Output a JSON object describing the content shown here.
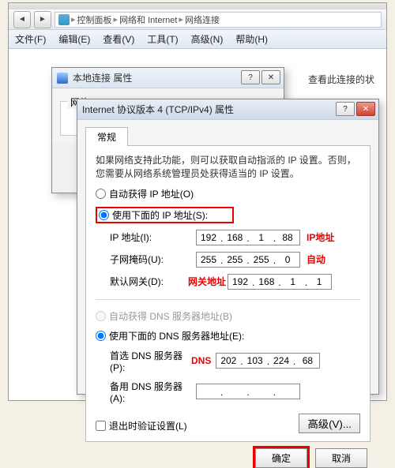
{
  "breadcrumb": {
    "item1": "控制面板",
    "item2": "网络和 Internet",
    "item3": "网络连接"
  },
  "menu": {
    "file": "文件(F)",
    "edit": "编辑(E)",
    "view": "查看(V)",
    "tools": "工具(T)",
    "advanced": "高级(N)",
    "help": "帮助(H)"
  },
  "statusHint": "查看此连接的状",
  "propDialog": {
    "title": "本地连接 属性",
    "groupLabel": "网络"
  },
  "ipv4": {
    "title": "Internet 协议版本 4 (TCP/IPv4) 属性",
    "tab": "常规",
    "desc": "如果网络支持此功能，则可以获取自动指派的 IP 设置。否则，您需要从网络系统管理员处获得适当的 IP 设置。",
    "autoIp": "自动获得 IP 地址(O)",
    "useIp": "使用下面的 IP 地址(S):",
    "ipLabel": "IP 地址(I):",
    "maskLabel": "子网掩码(U):",
    "gwLabel": "默认网关(D):",
    "ip": {
      "a": "192",
      "b": "168",
      "c": "1",
      "d": "88"
    },
    "mask": {
      "a": "255",
      "b": "255",
      "c": "255",
      "d": "0"
    },
    "gw": {
      "a": "192",
      "b": "168",
      "c": "1",
      "d": "1"
    },
    "autoDns": "自动获得 DNS 服务器地址(B)",
    "useDns": "使用下面的 DNS 服务器地址(E):",
    "dns1Label": "首选 DNS 服务器(P):",
    "dns2Label": "备用 DNS 服务器(A):",
    "dns1": {
      "a": "202",
      "b": "103",
      "c": "224",
      "d": "68"
    },
    "exitValidate": "退出时验证设置(L)",
    "advanced": "高级(V)...",
    "ok": "确定",
    "cancel": "取消"
  },
  "annotations": {
    "ipAddr": "IP地址",
    "auto": "自动",
    "gateway": "网关地址",
    "dns": "DNS"
  }
}
